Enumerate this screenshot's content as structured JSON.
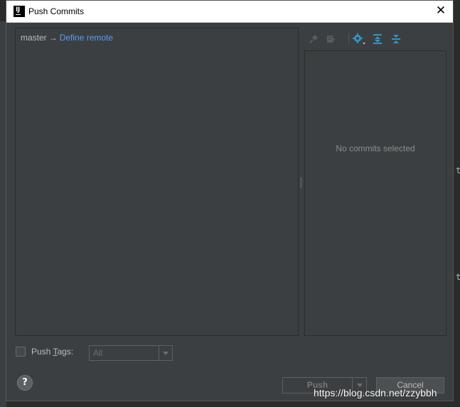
{
  "window": {
    "title": "Push Commits",
    "close_glyph": "✕",
    "app_icon": "intellij-icon"
  },
  "branch": {
    "local": "master",
    "arrow": "→",
    "remote_link": "Define remote"
  },
  "toolbar": {
    "icons": [
      "pin-icon",
      "edit-commit-icon",
      "settings-icon",
      "expand-all-icon",
      "collapse-all-icon"
    ]
  },
  "details": {
    "empty_text": "No commits selected"
  },
  "push_tags": {
    "label_prefix": "Push ",
    "label_mnemonic": "T",
    "label_suffix": "ags:",
    "checked": false,
    "select_value": "All"
  },
  "buttons": {
    "help": "?",
    "push": "Push",
    "cancel": "Cancel"
  },
  "background": {
    "glyph1": "t",
    "glyph2": "t"
  },
  "watermark": "https://blog.csdn.net/zzybbh",
  "colors": {
    "dialog_bg": "#3c3f41",
    "link": "#589df6",
    "text": "#bbbbbb",
    "icon_active": "#3592c4"
  }
}
